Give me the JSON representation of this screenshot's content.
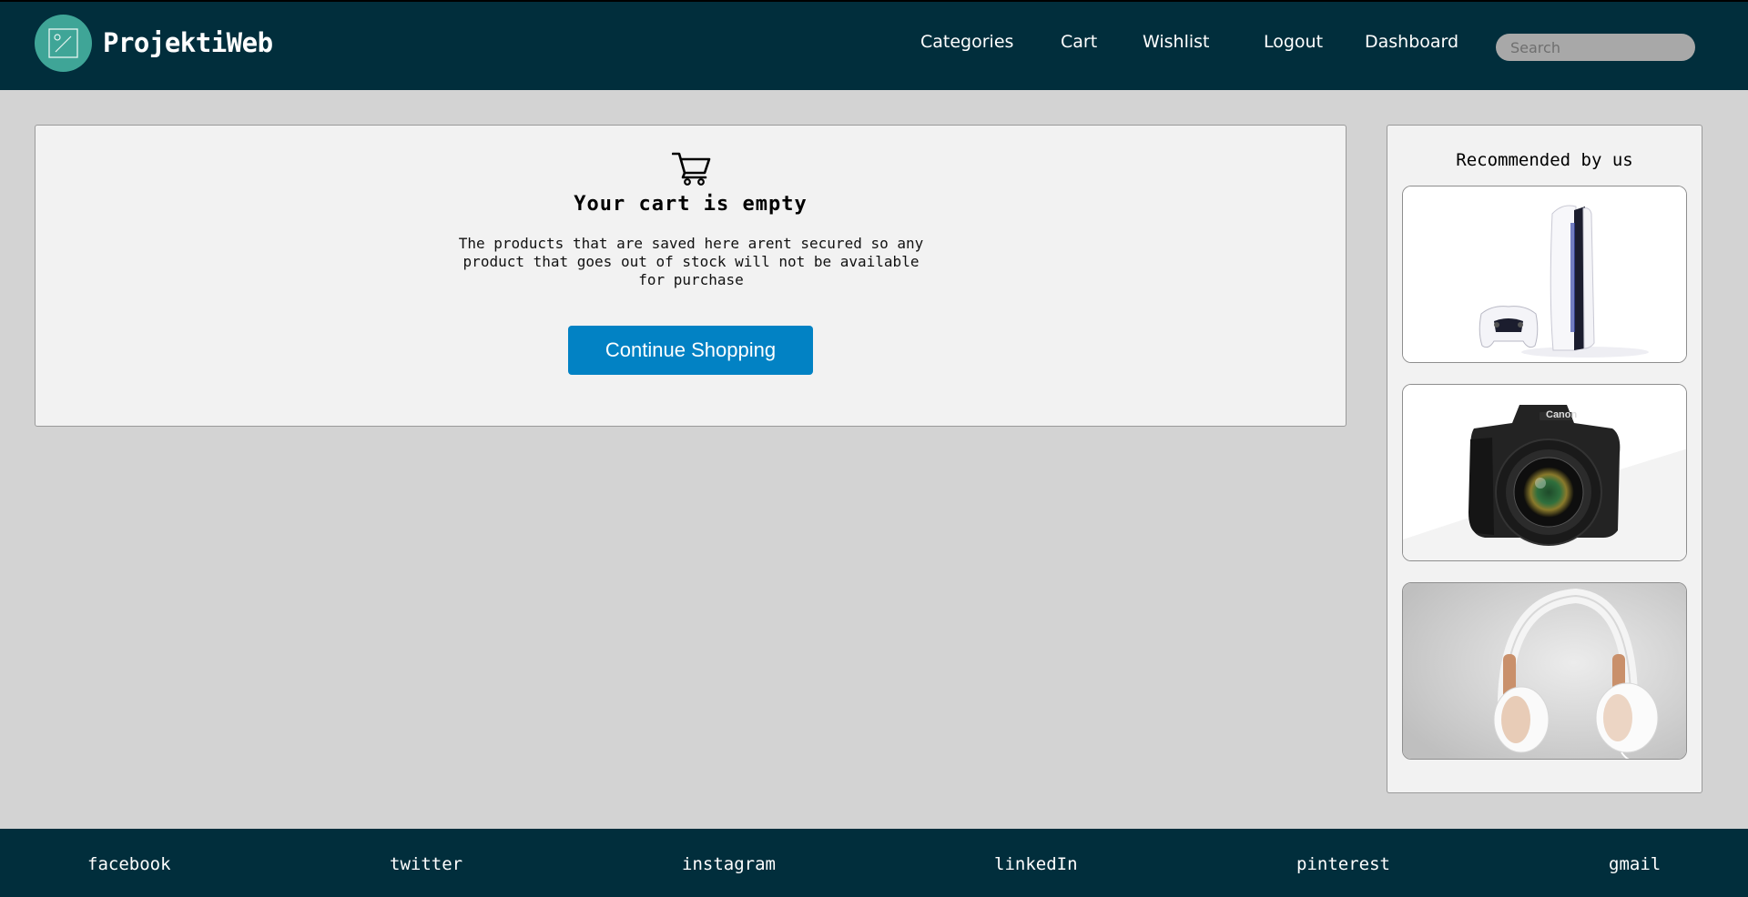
{
  "header": {
    "brand": "ProjektiWeb",
    "nav": [
      "Categories",
      "Cart",
      "Wishlist",
      "Logout",
      "Dashboard"
    ],
    "search_placeholder": "Search"
  },
  "cart": {
    "icon": "cart-icon",
    "title": "Your cart is empty",
    "description": "The products that are saved here arent secured so any product that goes out of stock will not be available for purchase",
    "button_label": "Continue Shopping"
  },
  "recommended": {
    "title": "Recommended by us",
    "items": [
      {
        "image": "game-console"
      },
      {
        "image": "dslr-camera"
      },
      {
        "image": "headphones"
      }
    ]
  },
  "footer": {
    "links": [
      "facebook",
      "twitter",
      "instagram",
      "linkedIn",
      "pinterest",
      "gmail"
    ]
  },
  "colors": {
    "header_bg": "#012e3c",
    "page_bg": "#d3d3d3",
    "logo_bg": "#3fa597",
    "button_bg": "#0282c4"
  }
}
